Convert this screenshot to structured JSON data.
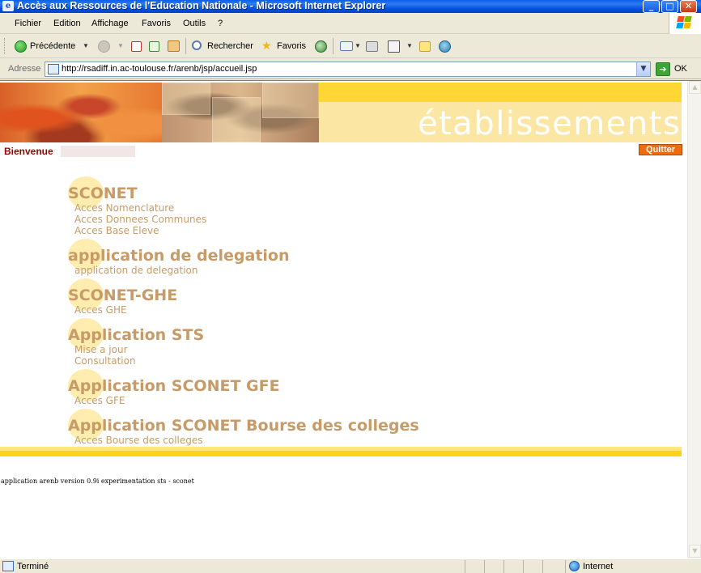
{
  "window": {
    "title": "Accès aux Ressources de l'Education Nationale - Microsoft Internet Explorer",
    "buttons": {
      "minimize": "_",
      "maximize": "□",
      "close": "✕"
    }
  },
  "menu": [
    "Fichier",
    "Edition",
    "Affichage",
    "Favoris",
    "Outils",
    "?"
  ],
  "toolbar": {
    "back_label": "Précédente",
    "search_label": "Rechercher",
    "favorites_label": "Favoris"
  },
  "address": {
    "label": "Adresse",
    "url": "http://rsadiff.in.ac-toulouse.fr/arenb/jsp/accueil.jsp",
    "go_label": "OK"
  },
  "banner": {
    "brand": "établissements"
  },
  "welcome": {
    "label": "Bienvenue",
    "quit_label": "Quitter"
  },
  "sections": [
    {
      "title": "SCONET",
      "links": [
        "Acces Nomenclature",
        "Acces Donnees Communes",
        "Acces Base Eleve"
      ]
    },
    {
      "title": "application de delegation",
      "links": [
        "application de delegation"
      ]
    },
    {
      "title": "SCONET-GHE",
      "links": [
        "Acces GHE"
      ]
    },
    {
      "title": "Application STS",
      "links": [
        "Mise a jour",
        "Consultation"
      ]
    },
    {
      "title": "Application SCONET GFE",
      "links": [
        "Acces GFE"
      ]
    },
    {
      "title": "Application SCONET Bourse des colleges",
      "links": [
        "Acces Bourse des colleges"
      ]
    }
  ],
  "footer": {
    "text": "application arenb version 0.9i experimentation sts - sconet"
  },
  "status": {
    "text": "Terminé",
    "zone": "Internet"
  },
  "colors": {
    "accent": "#c69b67",
    "welcome": "#990000",
    "quit": "#ec6c12",
    "band": "#ffd21a"
  }
}
